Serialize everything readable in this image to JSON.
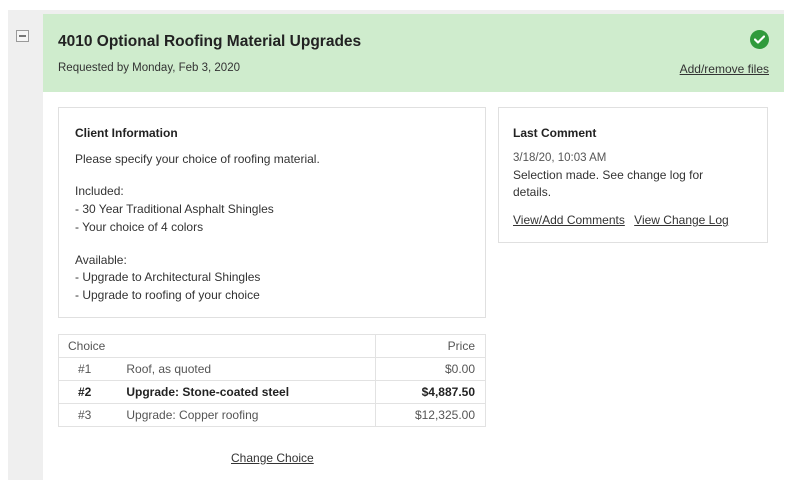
{
  "header": {
    "title": "4010 Optional Roofing Material Upgrades",
    "requested_by": "Requested by Monday, Feb 3, 2020",
    "add_files_label": "Add/remove files",
    "status_color": "#2f9a3b"
  },
  "client_info": {
    "title": "Client Information",
    "lines": [
      "Please specify your choice of roofing material.",
      "Included:",
      "- 30 Year Traditional Asphalt Shingles",
      "- Your choice of 4 colors",
      "Available:",
      "- Upgrade to Architectural Shingles",
      "- Upgrade to roofing of your choice"
    ]
  },
  "last_comment": {
    "title": "Last Comment",
    "date": "3/18/20, 10:03 AM",
    "text_line1": "Selection made. See change log for",
    "text_line2": "details.",
    "view_add_comments_label": "View/Add Comments",
    "view_change_log_label": "View Change Log"
  },
  "choices_table": {
    "headers": {
      "choice": "Choice",
      "price": "Price"
    },
    "rows": [
      {
        "num": "#1",
        "label": "Roof, as quoted",
        "price": "$0.00",
        "selected": false
      },
      {
        "num": "#2",
        "label": "Upgrade: Stone-coated steel",
        "price": "$4,887.50",
        "selected": true
      },
      {
        "num": "#3",
        "label": "Upgrade: Copper roofing",
        "price": "$12,325.00",
        "selected": false
      }
    ]
  },
  "change_choice_label": "Change Choice",
  "icons": {
    "collapse": "collapse-icon",
    "status": "check-circle-icon"
  },
  "colors": {
    "header_bg": "#cfeccd",
    "page_bg": "#efefef"
  }
}
